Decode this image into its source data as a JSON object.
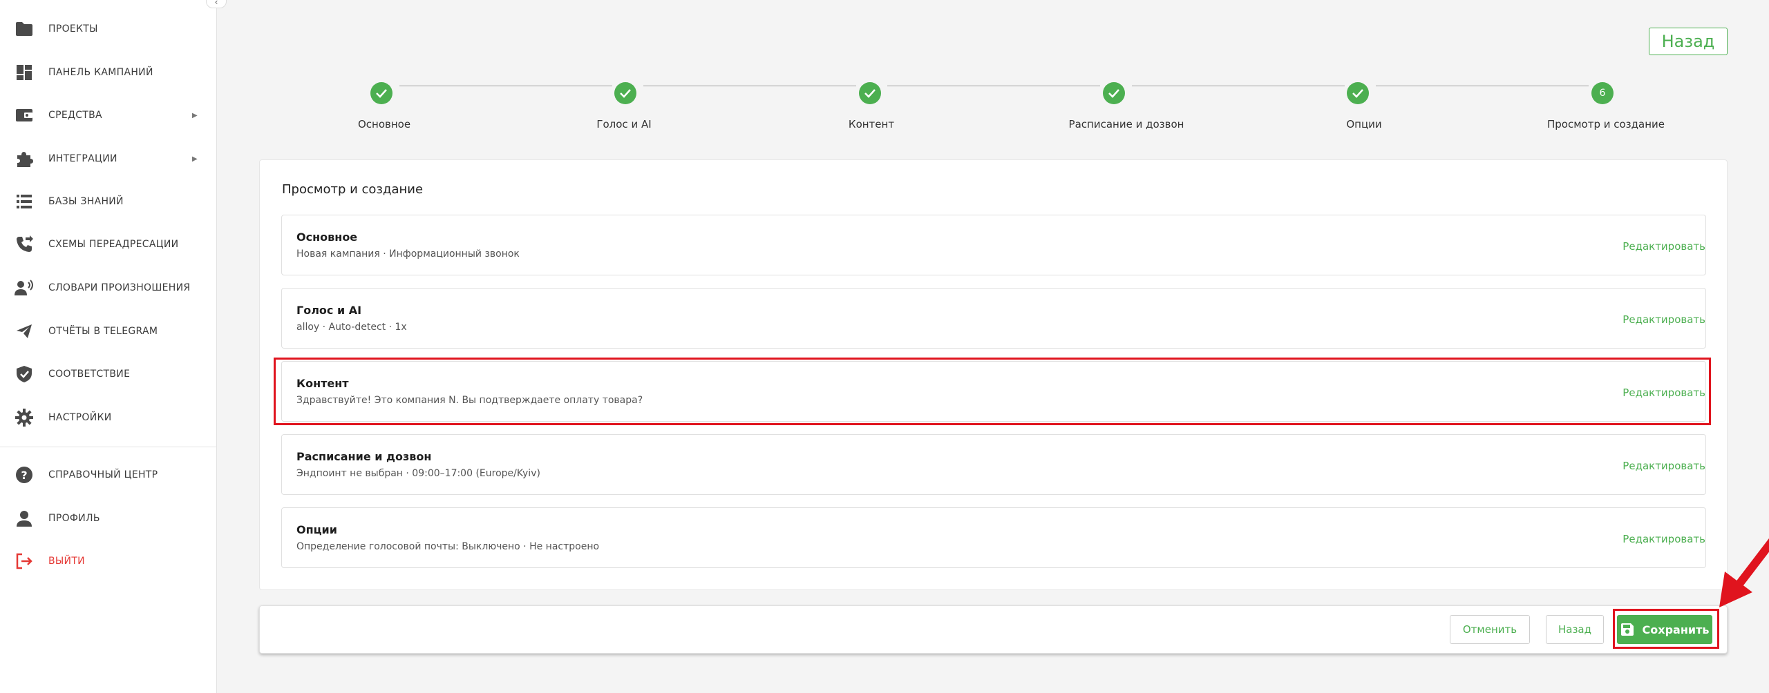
{
  "sidebar": {
    "items": [
      {
        "label": "ПРОЕКТЫ",
        "icon": "folder-icon"
      },
      {
        "label": "ПАНЕЛЬ КАМПАНИЙ",
        "icon": "dashboard-icon"
      },
      {
        "label": "СРЕДСТВА",
        "icon": "wallet-icon",
        "has_arrow": true
      },
      {
        "label": "ИНТЕГРАЦИИ",
        "icon": "puzzle-icon",
        "has_arrow": true
      },
      {
        "label": "БАЗЫ ЗНАНИЙ",
        "icon": "list-icon"
      },
      {
        "label": "СХЕМЫ ПЕРЕАДРЕСАЦИИ",
        "icon": "phone-forward-icon"
      },
      {
        "label": "СЛОВАРИ ПРОИЗНОШЕНИЯ",
        "icon": "speaker-person-icon"
      },
      {
        "label": "ОТЧЁТЫ В TELEGRAM",
        "icon": "send-icon"
      },
      {
        "label": "СООТВЕТСТВИЕ",
        "icon": "shield-icon"
      },
      {
        "label": "НАСТРОЙКИ",
        "icon": "gear-icon"
      }
    ],
    "bottom_items": [
      {
        "label": "СПРАВОЧНЫЙ ЦЕНТР",
        "icon": "help-icon"
      },
      {
        "label": "ПРОФИЛЬ",
        "icon": "person-icon"
      },
      {
        "label": "ВЫЙТИ",
        "icon": "logout-icon"
      }
    ]
  },
  "header": {
    "back_label": "Назад"
  },
  "stepper": {
    "steps": [
      {
        "label": "Основное",
        "state": "done"
      },
      {
        "label": "Голос и AI",
        "state": "done"
      },
      {
        "label": "Контент",
        "state": "done"
      },
      {
        "label": "Расписание и дозвон",
        "state": "done"
      },
      {
        "label": "Опции",
        "state": "done"
      },
      {
        "label": "Просмотр и создание",
        "state": "current",
        "number": "6"
      }
    ]
  },
  "review": {
    "title": "Просмотр и создание",
    "edit_label": "Редактировать",
    "sections": [
      {
        "title": "Основное",
        "summary": "Новая кампания · Информационный звонок"
      },
      {
        "title": "Голос и AI",
        "summary": "alloy · Auto-detect · 1x"
      },
      {
        "title": "Контент",
        "summary": "Здравствуйте! Это компания N. Вы подтверждаете оплату товара?"
      },
      {
        "title": "Расписание и дозвон",
        "summary": "Эндпоинт не выбран · 09:00–17:00 (Europe/Kyiv)"
      },
      {
        "title": "Опции",
        "summary": "Определение голосовой почты: Выключено · Не настроено"
      }
    ]
  },
  "actions": {
    "cancel_label": "Отменить",
    "back_label": "Назад",
    "save_label": "Сохранить"
  },
  "colors": {
    "accent": "#4caf50",
    "annotation": "#e0141e"
  }
}
